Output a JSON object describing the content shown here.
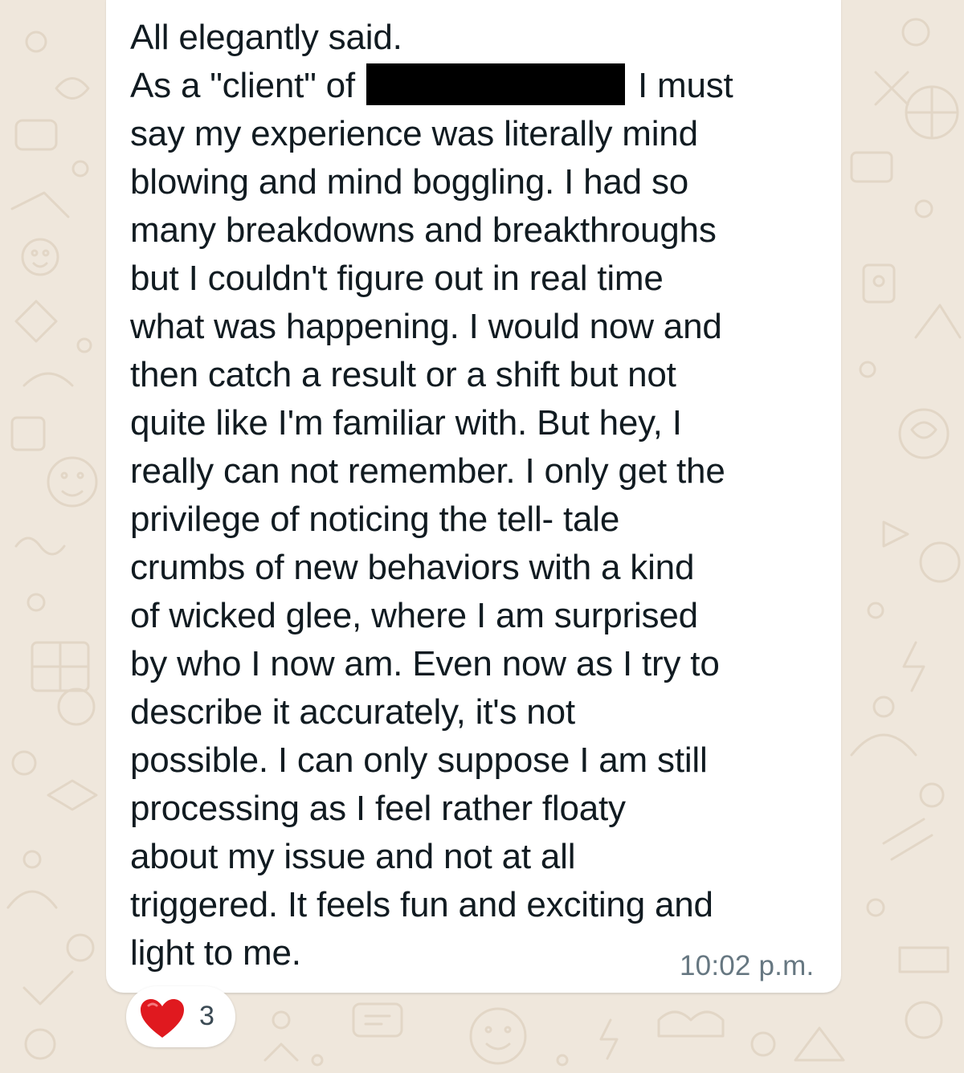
{
  "message": {
    "lines": [
      "All elegantly said.",
      "As a \"client\" of",
      "I must",
      "say my experience was literally mind",
      "blowing and mind boggling. I had so",
      "many breakdowns and breakthroughs",
      "but I couldn't figure out in real time",
      "what was happening. I would now and",
      "then catch a result or a shift but not",
      "quite like I'm familiar with. But hey, I",
      "really can not remember. I only get the",
      "privilege of noticing the tell- tale",
      "crumbs of new behaviors with a kind",
      "of wicked glee, where I am surprised",
      "by who I now am. Even now as I try to",
      "describe it accurately, it's not",
      "possible. I can only suppose I am still",
      "processing as I feel rather floaty",
      "about my issue and not at all",
      "triggered. It feels fun and exciting and",
      "light to me."
    ],
    "timestamp": "10:02 p.m.",
    "reaction": {
      "emoji": "heart-icon",
      "count": "3",
      "color": "#e0191f"
    }
  },
  "colors": {
    "wallpaper": "#efe7dc",
    "bubble": "#ffffff",
    "text": "#111b21",
    "timestamp": "#667781"
  }
}
